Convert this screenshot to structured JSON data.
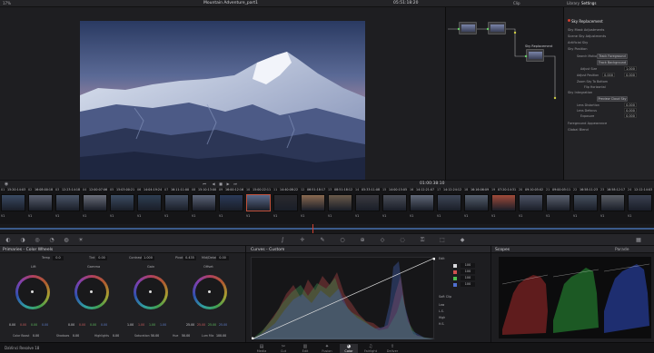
{
  "topbar": {
    "zoom": "17%",
    "project": "Mountain Adventure_part1",
    "timecode": "05:51:18:20",
    "clip_menu": "Clip",
    "tab_library": "Library",
    "tab_settings": "Settings"
  },
  "viewer": {
    "timecode": "01:00:38:10"
  },
  "clips": [
    {
      "num": "01",
      "tc": "15:20:14:03",
      "v": "V1",
      "c": "#3a4a63"
    },
    {
      "num": "02",
      "tc": "16:08:00:18",
      "v": "V1",
      "c": "#5a6070"
    },
    {
      "num": "03",
      "tc": "12:23:14:18",
      "v": "V1",
      "c": "#4a5568"
    },
    {
      "num": "04",
      "tc": "12:00:07:06",
      "v": "V1",
      "c": "#6a6e7a"
    },
    {
      "num": "05",
      "tc": "15:03:00:21",
      "v": "V1",
      "c": "#3c4c62"
    },
    {
      "num": "06",
      "tc": "14:04:19:24",
      "v": "V1",
      "c": "#2e3e52"
    },
    {
      "num": "07",
      "tc": "16:11:11:00",
      "v": "V1",
      "c": "#465266"
    },
    {
      "num": "08",
      "tc": "15:10:13:00",
      "v": "V1",
      "c": "#5c6478"
    },
    {
      "num": "09",
      "tc": "16:00:12:16",
      "v": "V1",
      "c": "#2b3a58"
    },
    {
      "num": "10",
      "tc": "15:00:22:11",
      "v": "V1",
      "c": "#5a6a8a"
    },
    {
      "num": "11",
      "tc": "14:40:08:22",
      "v": "V1",
      "c": "#2a2a2e"
    },
    {
      "num": "12",
      "tc": "06:51:18:17",
      "v": "V1",
      "c": "#8a6a50"
    },
    {
      "num": "13",
      "tc": "08:51:18:12",
      "v": "V1",
      "c": "#6a5a4a"
    },
    {
      "num": "14",
      "tc": "05:33:11:08",
      "v": "V1",
      "c": "#3a3a40"
    },
    {
      "num": "15",
      "tc": "14:00:15:05",
      "v": "V1",
      "c": "#4a4e58"
    },
    {
      "num": "16",
      "tc": "14:12:21:07",
      "v": "V1",
      "c": "#606878"
    },
    {
      "num": "17",
      "tc": "14:12:24:12",
      "v": "V1",
      "c": "#3e4656"
    },
    {
      "num": "18",
      "tc": "16:16:06:09",
      "v": "V1",
      "c": "#56606e"
    },
    {
      "num": "19",
      "tc": "07:20:14:31",
      "v": "V1",
      "c": "#a04a3a"
    },
    {
      "num": "20",
      "tc": "09:10:05:02",
      "v": "V1",
      "c": "#4e5466"
    },
    {
      "num": "21",
      "tc": "09:00:05:11",
      "v": "V1",
      "c": "#5c6270"
    },
    {
      "num": "22",
      "tc": "16:58:11:23",
      "v": "V1",
      "c": "#46505e"
    },
    {
      "num": "23",
      "tc": "16:58:12:17",
      "v": "V1",
      "c": "#5a5e66"
    },
    {
      "num": "24",
      "tc": "12:12:14:03",
      "v": "V1",
      "c": "#3a4050"
    }
  ],
  "nodes": {
    "sky_label": "Sky Replacement",
    "n1": "01",
    "n2": "02",
    "n3": "03"
  },
  "fx": {
    "title": "Sky Replacement",
    "rows": [
      "Sky Mask Adjustments",
      "Scene Sky Adjustments",
      "Artificial Sky",
      "Sky Position"
    ],
    "search_motion": "Search Motion",
    "track_fg": "Track Foreground",
    "track_bg": "Track Background",
    "adjust_size": "Adjust Size",
    "adjust_size_val": "1.000",
    "adjust_position": "Adjust Position",
    "pos_x": "0.000",
    "pos_y": "0.000",
    "zoom_to_bottom": "Zoom Sky To Bottom",
    "flip_horizontal": "Flip Horizontal",
    "sky_integration": "Sky Integration",
    "preview_cloud": "Preview Cloud Sky",
    "lens_distortion": "Lens Distortion",
    "lens_distortion_val": "0.000",
    "lens_defocus": "Lens Defocus",
    "lens_defocus_val": "0.000",
    "exposure": "Exposure",
    "exposure_val": "0.000",
    "foreground_appearance": "Foreground Appearance",
    "global_blend": "Global Blend"
  },
  "wheels": {
    "title": "Primaries - Color Wheels",
    "temp_label": "Temp",
    "temp": "0.0",
    "tint_label": "Tint",
    "tint": "0.00",
    "contrast_label": "Contrast",
    "contrast": "1.000",
    "pivot_label": "Pivot",
    "pivot": "0.435",
    "mids_label": "Mid/Detail",
    "mids": "0.00",
    "items": [
      {
        "name": "Lift",
        "vals": [
          "0.00",
          "0.00",
          "0.00",
          "0.00"
        ]
      },
      {
        "name": "Gamma",
        "vals": [
          "0.00",
          "0.00",
          "0.00",
          "0.00"
        ]
      },
      {
        "name": "Gain",
        "vals": [
          "1.00",
          "1.00",
          "1.00",
          "1.00"
        ]
      },
      {
        "name": "Offset",
        "vals": [
          "25.00",
          "25.00",
          "25.00",
          "25.00"
        ]
      }
    ],
    "color_boost_label": "Color Boost",
    "color_boost": "0.00",
    "shadows_label": "Shadows",
    "shadows": "0.00",
    "highlights_label": "Highlights",
    "highlights": "0.00",
    "saturation_label": "Saturation",
    "saturation": "50.00",
    "hue_label": "Hue",
    "hue": "50.00",
    "lum_mix_label": "Lum Mix",
    "lum_mix": "100.00"
  },
  "curves": {
    "title": "Curves - Custom",
    "edit_label": "Edit",
    "edit_vals": [
      "100",
      "100",
      "100",
      "100"
    ],
    "soft_clip_label": "Soft Clip",
    "low": "Low",
    "high": "High",
    "ls": "L.S.",
    "hs": "H.S."
  },
  "scopes": {
    "title": "Scopes",
    "mode": "Parade"
  },
  "bottom": {
    "app": "DaVinci Resolve 18",
    "pages": [
      "Media",
      "Cut",
      "Edit",
      "Fusion",
      "Color",
      "Fairlight",
      "Deliver"
    ],
    "active": 4
  }
}
